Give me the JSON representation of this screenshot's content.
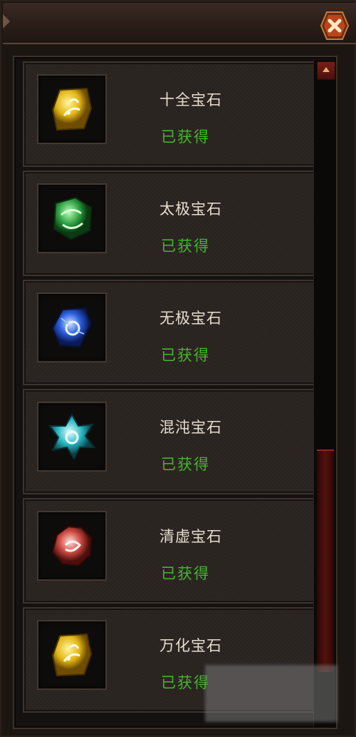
{
  "dialog": {
    "close_icon": "close-x-icon"
  },
  "gems": [
    {
      "name": "十全宝石",
      "status": "已获得",
      "icon": "gem-gold-icon",
      "color": "#e8c21c"
    },
    {
      "name": "太极宝石",
      "status": "已获得",
      "icon": "gem-green-icon",
      "color": "#2fa24a"
    },
    {
      "name": "无极宝石",
      "status": "已获得",
      "icon": "gem-blue-icon",
      "color": "#2a63d6"
    },
    {
      "name": "混沌宝石",
      "status": "已获得",
      "icon": "gem-cyan-icon",
      "color": "#34c2c9"
    },
    {
      "name": "清虚宝石",
      "status": "已获得",
      "icon": "gem-red-icon",
      "color": "#d24a42"
    },
    {
      "name": "万化宝石",
      "status": "已获得",
      "icon": "gem-gold-icon",
      "color": "#e8c21c"
    }
  ],
  "scrollbar": {
    "position_fraction": 0.62
  }
}
